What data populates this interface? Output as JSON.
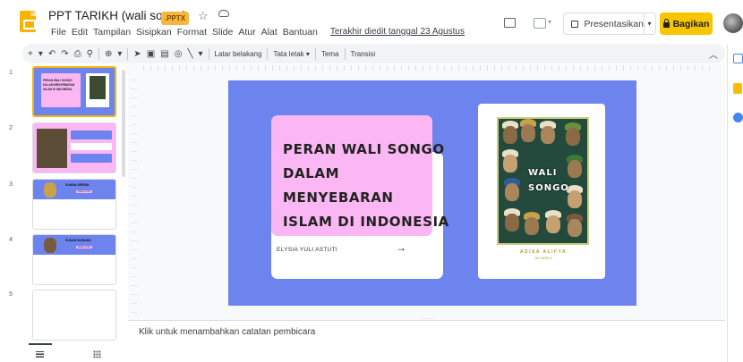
{
  "header": {
    "doc_title": "PPT TARIKH (wali songo)",
    "badge": ".PPTX",
    "last_edit": "Terakhir diedit tanggal 23 Agustus",
    "present_label": "Presentasikan",
    "share_label": "Bagikan"
  },
  "menu": [
    "File",
    "Edit",
    "Tampilan",
    "Sisipkan",
    "Format",
    "Slide",
    "Atur",
    "Alat",
    "Bantuan"
  ],
  "toolbar": {
    "background": "Latar belakang",
    "layout": "Tata letak",
    "theme": "Tema",
    "transition": "Transisi"
  },
  "filmstrip": {
    "slides": [
      {
        "num": "1",
        "title": "PERAN WALI SONGO DALAM MENYEBARAN ISLAM DI INDONESIA"
      },
      {
        "num": "2"
      },
      {
        "num": "3",
        "title": "SUNAN GRESIK",
        "button": "Detail 1 hari"
      },
      {
        "num": "4",
        "title": "SUNAN BONANG",
        "button": "Detail 1 hari"
      },
      {
        "num": "5"
      }
    ]
  },
  "slide": {
    "title_lines": [
      "PERAN WALI SONGO",
      "DALAM",
      "MENYEBARAN",
      "ISLAM DI INDONESIA"
    ],
    "author": "ELYSIA YULI ASTUTI",
    "arrow": "→",
    "book_title_lines": [
      "WALI",
      "SONGO"
    ],
    "book_caption": "ADISA ALIFYA",
    "book_sub": "SD MIPA II"
  },
  "notes_placeholder": "Klik untuk menambahkan catatan pembicara",
  "colors": {
    "accent": "#f4b400",
    "slide_bg": "#6d84ef",
    "card_pink": "#fbb7f3",
    "share_yellow": "#f9c400"
  }
}
